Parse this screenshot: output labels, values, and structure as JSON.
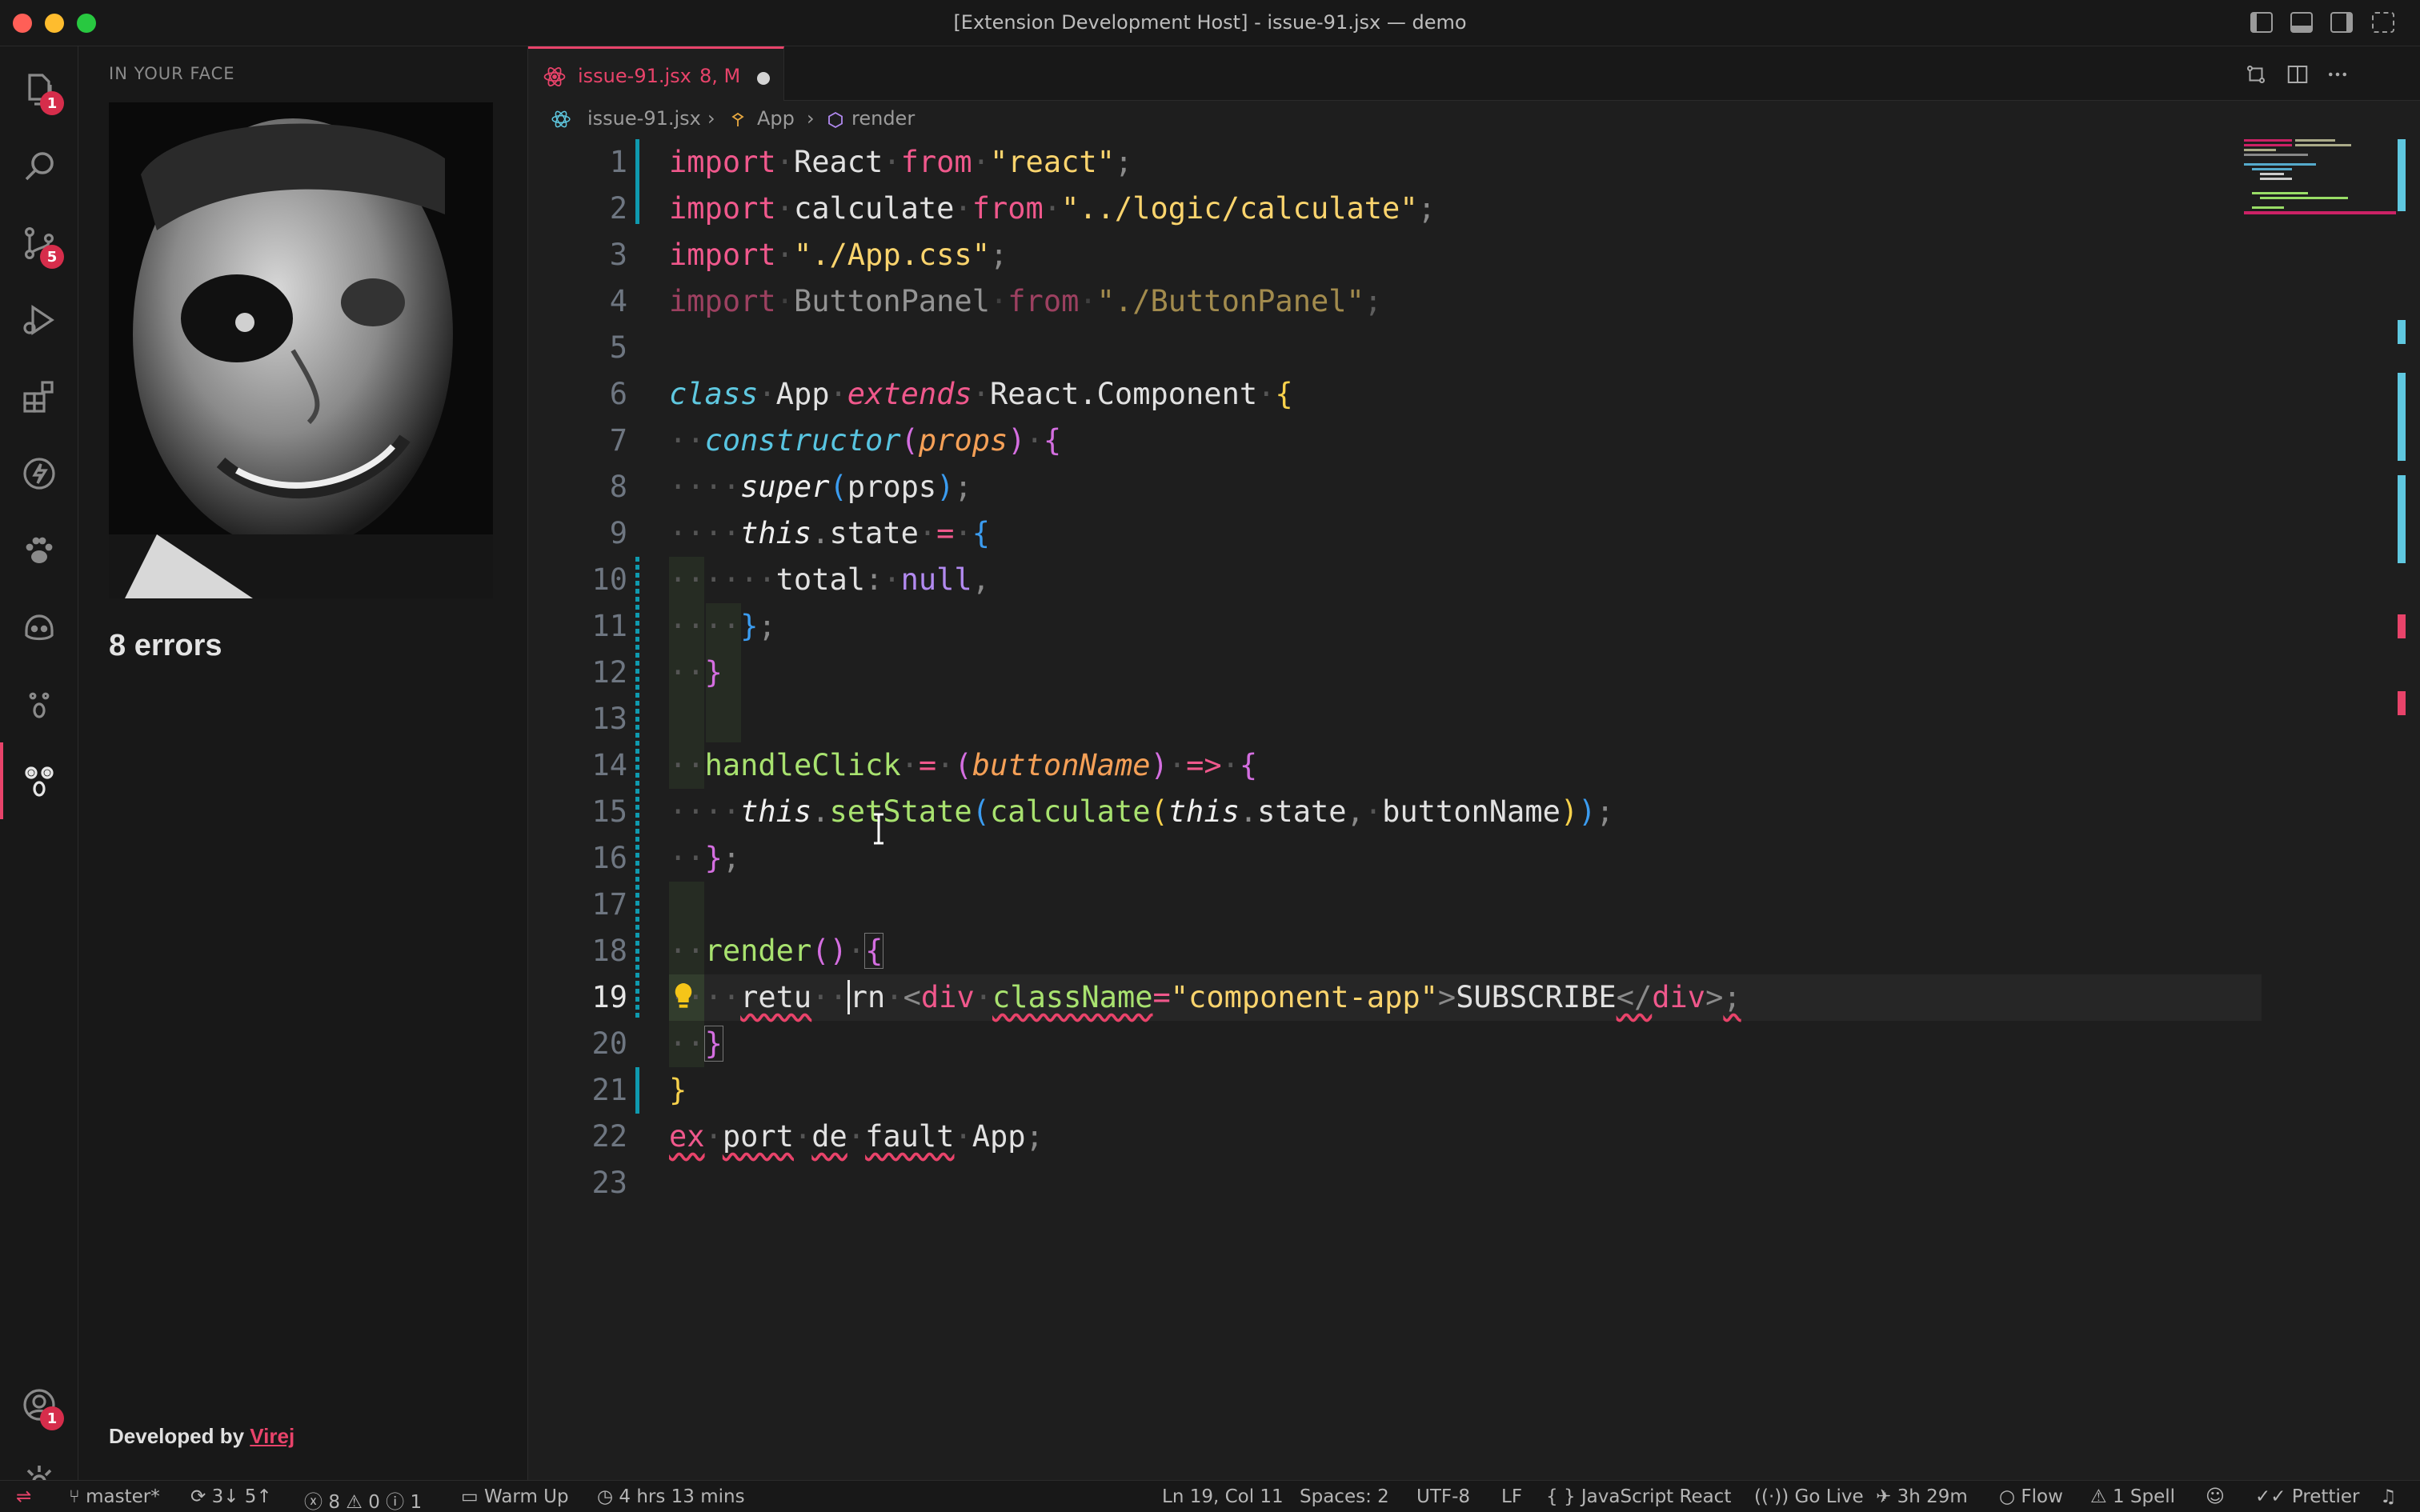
{
  "window": {
    "title": "[Extension Development Host] - issue-91.jsx — demo",
    "colors": {
      "close": "#ff5f57",
      "minimize": "#febc2e",
      "maximize": "#28c840",
      "accent": "#e8436a",
      "badge": "#d62d4b"
    }
  },
  "activity_bar": {
    "items": [
      {
        "name": "explorer-icon",
        "badge": "1"
      },
      {
        "name": "search-icon",
        "badge": ""
      },
      {
        "name": "source-control-icon",
        "badge": "5"
      },
      {
        "name": "run-debug-icon",
        "badge": ""
      },
      {
        "name": "extensions-icon",
        "badge": ""
      },
      {
        "name": "lightning-icon",
        "badge": ""
      },
      {
        "name": "paw-icon",
        "badge": ""
      },
      {
        "name": "copilot-icon",
        "badge": ""
      },
      {
        "name": "face-icon",
        "badge": ""
      },
      {
        "name": "in-your-face-icon",
        "badge": ""
      }
    ],
    "accounts_badge": "1"
  },
  "sidebar": {
    "title": "IN YOUR FACE",
    "error_count": "8 errors",
    "developed_by_prefix": "Developed by",
    "developer_name": "Virej"
  },
  "tab": {
    "filename": "issue-91.jsx",
    "status": "8, M"
  },
  "breadcrumb": {
    "file": "issue-91.jsx",
    "class": "App",
    "method": "render"
  },
  "editor": {
    "line_numbers": [
      "1",
      "2",
      "3",
      "4",
      "5",
      "6",
      "7",
      "8",
      "9",
      "10",
      "11",
      "12",
      "13",
      "14",
      "15",
      "16",
      "17",
      "18",
      "19",
      "20",
      "21",
      "22",
      "23"
    ],
    "current_line": 19
  },
  "status_bar": {
    "branch": "master*",
    "sync": "3↓ 5↑",
    "errors": "8",
    "warnings": "0",
    "info": "1",
    "warm_up": "Warm Up",
    "time_tracked": "4 hrs 13 mins",
    "cursor": "Ln 19, Col 11",
    "spaces": "Spaces: 2",
    "encoding": "UTF-8",
    "eol": "LF",
    "language": "JavaScript React",
    "go_live": "Go Live",
    "session": "3h 29m",
    "flow": "Flow",
    "spell": "1 Spell",
    "prettier": "Prettier"
  }
}
